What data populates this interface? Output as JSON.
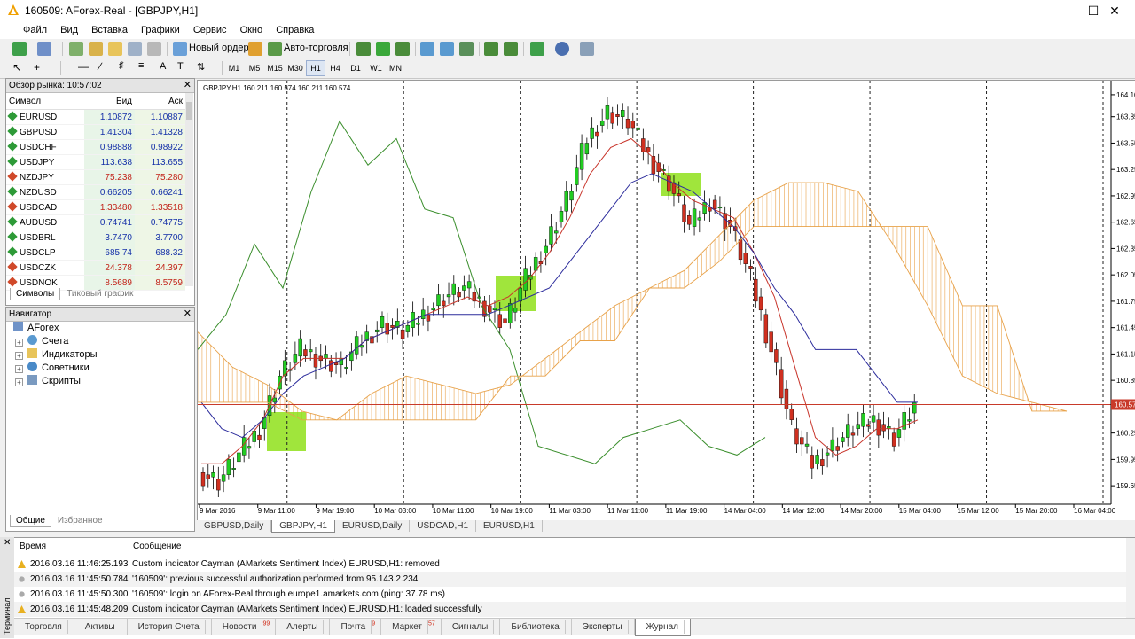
{
  "window": {
    "title": "160509: AForex-Real - [GBPJPY,H1]"
  },
  "menu": [
    "Файл",
    "Вид",
    "Вставка",
    "Графики",
    "Сервис",
    "Окно",
    "Справка"
  ],
  "toolbar": {
    "new_order": "Новый ордер",
    "auto_trading": "Авто-торговля"
  },
  "timeframes": [
    "M1",
    "M5",
    "M15",
    "M30",
    "H1",
    "H4",
    "D1",
    "W1",
    "MN"
  ],
  "active_timeframe": "H1",
  "market_watch": {
    "title": "Обзор рынка: 10:57:02",
    "columns": [
      "Символ",
      "Бид",
      "Аск"
    ],
    "rows": [
      {
        "symbol": "EURUSD",
        "bid": "1.10872",
        "ask": "1.10887",
        "dir": "up"
      },
      {
        "symbol": "GBPUSD",
        "bid": "1.41304",
        "ask": "1.41328",
        "dir": "up"
      },
      {
        "symbol": "USDCHF",
        "bid": "0.98888",
        "ask": "0.98922",
        "dir": "up"
      },
      {
        "symbol": "USDJPY",
        "bid": "113.638",
        "ask": "113.655",
        "dir": "up"
      },
      {
        "symbol": "NZDJPY",
        "bid": "75.238",
        "ask": "75.280",
        "dir": "down"
      },
      {
        "symbol": "NZDUSD",
        "bid": "0.66205",
        "ask": "0.66241",
        "dir": "up"
      },
      {
        "symbol": "USDCAD",
        "bid": "1.33480",
        "ask": "1.33518",
        "dir": "down"
      },
      {
        "symbol": "AUDUSD",
        "bid": "0.74741",
        "ask": "0.74775",
        "dir": "up"
      },
      {
        "symbol": "USDBRL",
        "bid": "3.7470",
        "ask": "3.7700",
        "dir": "up"
      },
      {
        "symbol": "USDCLP",
        "bid": "685.74",
        "ask": "688.32",
        "dir": "up"
      },
      {
        "symbol": "USDCZK",
        "bid": "24.378",
        "ask": "24.397",
        "dir": "down"
      },
      {
        "symbol": "USDNOK",
        "bid": "8.5689",
        "ask": "8.5759",
        "dir": "down"
      }
    ],
    "tabs": [
      "Символы",
      "Тиковый график"
    ]
  },
  "navigator": {
    "title": "Навигатор",
    "root": "AForex",
    "items": [
      "Счета",
      "Индикаторы",
      "Советники",
      "Скрипты"
    ],
    "tabs": [
      "Общие",
      "Избранное"
    ]
  },
  "chart": {
    "header": "GBPJPY,H1  160.211 160.574 160.211 160.574",
    "current_price": "160.57",
    "tabs": [
      "GBPUSD,Daily",
      "GBPJPY,H1",
      "EURUSD,Daily",
      "USDCAD,H1",
      "EURUSD,H1"
    ],
    "active_tab": "GBPJPY,H1"
  },
  "chart_data": {
    "type": "line",
    "symbol": "GBPJPY",
    "timeframe": "H1",
    "x_ticks": [
      "9 Mar 2016",
      "9 Mar 11:00",
      "9 Mar 19:00",
      "10 Mar 03:00",
      "10 Mar 11:00",
      "10 Mar 19:00",
      "11 Mar 03:00",
      "11 Mar 11:00",
      "11 Mar 19:00",
      "14 Mar 04:00",
      "14 Mar 12:00",
      "14 Mar 20:00",
      "15 Mar 04:00",
      "15 Mar 12:00",
      "15 Mar 20:00",
      "16 Mar 04:00"
    ],
    "y_ticks": [
      "164.10",
      "163.85",
      "163.55",
      "163.25",
      "162.95",
      "162.65",
      "162.35",
      "162.05",
      "161.75",
      "161.45",
      "161.15",
      "160.85",
      "160.55",
      "160.25",
      "159.95",
      "159.65"
    ],
    "ylim": [
      159.5,
      164.2
    ],
    "last_price": 160.574,
    "grid": false,
    "series": [
      {
        "name": "Close",
        "color": "#2a8a1e",
        "values": [
          159.8,
          159.7,
          160.0,
          160.3,
          160.9,
          161.2,
          161.1,
          161.0,
          161.3,
          161.5,
          161.4,
          161.6,
          161.8,
          161.9,
          161.7,
          161.5,
          162.0,
          162.4,
          162.9,
          163.6,
          163.9,
          163.8,
          163.4,
          163.1,
          162.6,
          162.9,
          162.6,
          162.0,
          161.2,
          160.3,
          159.9,
          160.1,
          160.3,
          160.4,
          160.2,
          160.57
        ]
      },
      {
        "name": "Tenkan",
        "color": "#c8342a",
        "values": [
          159.9,
          159.9,
          160.1,
          160.4,
          160.9,
          161.1,
          161.1,
          161.1,
          161.3,
          161.4,
          161.5,
          161.6,
          161.7,
          161.8,
          161.7,
          161.8,
          162.0,
          162.3,
          162.7,
          163.2,
          163.5,
          163.6,
          163.4,
          163.1,
          162.9,
          162.8,
          162.7,
          162.3,
          161.8,
          161.0,
          160.2,
          160.0,
          160.1,
          160.3,
          160.3,
          160.4
        ]
      },
      {
        "name": "Kijun",
        "color": "#2c2c9c",
        "values": [
          160.6,
          160.3,
          160.2,
          160.4,
          160.7,
          160.9,
          161.0,
          161.1,
          161.3,
          161.4,
          161.5,
          161.6,
          161.6,
          161.6,
          161.6,
          161.7,
          161.8,
          161.9,
          162.2,
          162.5,
          162.8,
          163.1,
          163.2,
          163.1,
          163.0,
          162.8,
          162.6,
          162.3,
          161.9,
          161.6,
          161.2,
          161.2,
          161.2,
          160.9,
          160.6,
          160.6
        ]
      },
      {
        "name": "Chikou",
        "color": "#3a8e2c",
        "values": [
          161.2,
          161.6,
          162.4,
          161.9,
          163.0,
          163.8,
          163.3,
          163.6,
          162.8,
          162.7,
          161.7,
          161.2,
          160.1,
          160.0,
          159.9,
          160.2,
          160.3,
          160.4,
          160.1,
          160.0,
          160.2
        ]
      },
      {
        "name": "Senkou A",
        "color": "#e8a24a",
        "values": [
          161.4,
          161.0,
          160.8,
          160.5,
          160.4,
          160.7,
          160.9,
          160.8,
          160.7,
          160.8,
          161.1,
          161.4,
          161.7,
          161.9,
          162.1,
          162.5,
          162.9,
          163.1,
          163.1,
          163.0,
          162.4,
          161.7,
          160.9,
          160.7,
          160.6,
          160.5
        ]
      },
      {
        "name": "Senkou B",
        "color": "#e8a24a",
        "values": [
          160.6,
          160.6,
          160.6,
          160.4,
          160.4,
          160.4,
          160.4,
          160.4,
          160.4,
          160.9,
          160.9,
          161.3,
          161.3,
          161.9,
          161.9,
          162.2,
          162.6,
          162.6,
          162.6,
          162.6,
          162.6,
          162.6,
          161.7,
          161.7,
          160.5,
          160.5
        ]
      }
    ]
  },
  "terminal": {
    "columns": [
      "Время",
      "Сообщение"
    ],
    "side_label": "Терминал",
    "rows": [
      {
        "time": "2016.03.16 11:46:25.193",
        "msg": "Custom indicator Cayman (AMarkets Sentiment Index) EURUSD,H1: removed",
        "type": "warn"
      },
      {
        "time": "2016.03.16 11:45:50.784",
        "msg": "'160509': previous successful authorization performed from 95.143.2.234",
        "type": "info"
      },
      {
        "time": "2016.03.16 11:45:50.300",
        "msg": "'160509': login on AForex-Real through europe1.amarkets.com (ping: 37.78 ms)",
        "type": "info"
      },
      {
        "time": "2016.03.16 11:45:48.209",
        "msg": "Custom indicator Cayman (AMarkets Sentiment Index) EURUSD,H1: loaded successfully",
        "type": "warn"
      }
    ],
    "tabs": [
      {
        "label": "Торговля",
        "badge": ""
      },
      {
        "label": "Активы",
        "badge": ""
      },
      {
        "label": "История Счета",
        "badge": ""
      },
      {
        "label": "Новости",
        "badge": "99"
      },
      {
        "label": "Алерты",
        "badge": ""
      },
      {
        "label": "Почта",
        "badge": "9"
      },
      {
        "label": "Маркет",
        "badge": "57"
      },
      {
        "label": "Сигналы",
        "badge": ""
      },
      {
        "label": "Библиотека",
        "badge": ""
      },
      {
        "label": "Эксперты",
        "badge": ""
      },
      {
        "label": "Журнал",
        "badge": ""
      }
    ],
    "active_tab": "Журнал"
  },
  "colors": {
    "bull": "#22cc22",
    "bear": "#d03020",
    "cloud": "#e8a24a",
    "highlight": "#8fe01a",
    "price_line": "#c83a2a"
  }
}
